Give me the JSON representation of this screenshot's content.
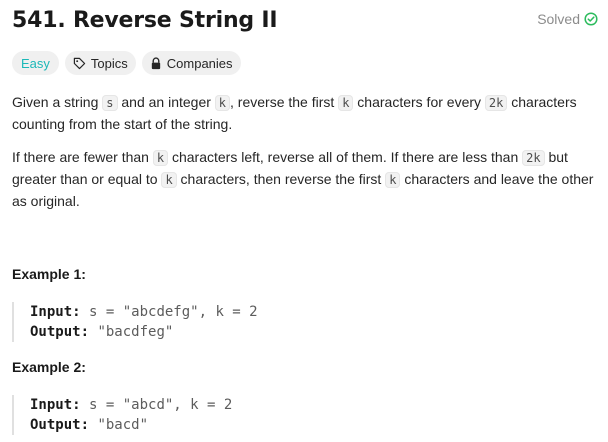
{
  "problem": {
    "title": "541. Reverse String II",
    "status": "Solved",
    "tags": {
      "difficulty": "Easy",
      "topics": "Topics",
      "companies": "Companies"
    }
  },
  "description": {
    "p1": [
      "Given a string ",
      "s",
      " and an integer ",
      "k",
      ", reverse the first ",
      "k",
      " characters for every ",
      "2k",
      " characters counting from the start of the string."
    ],
    "p2": [
      "If there are fewer than ",
      "k",
      " characters left, reverse all of them. If there are less than ",
      "2k",
      " but greater than or equal to ",
      "k",
      " characters, then reverse the first ",
      "k",
      " characters and leave the other as original."
    ]
  },
  "examples": [
    {
      "title": "Example 1:",
      "input_label": "Input:",
      "input_value": "s = \"abcdefg\", k = 2",
      "output_label": "Output:",
      "output_value": "\"bacdfeg\""
    },
    {
      "title": "Example 2:",
      "input_label": "Input:",
      "input_value": "s = \"abcd\", k = 2",
      "output_label": "Output:",
      "output_value": "\"bacd\""
    }
  ],
  "colors": {
    "easy": "#1cb8b8",
    "solved_check": "#2cbb5d",
    "tag_bg": "#f0f0f0"
  },
  "icons": {
    "solved": "check-circle-icon",
    "topics": "tag-icon",
    "companies": "lock-icon"
  }
}
